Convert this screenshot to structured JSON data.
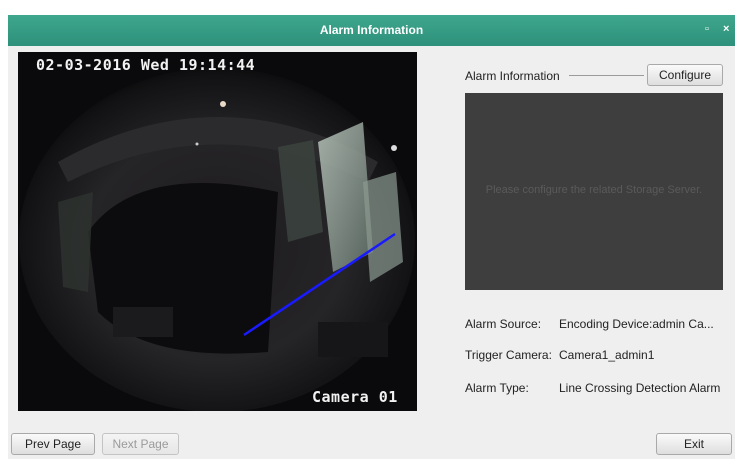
{
  "window": {
    "title": "Alarm Information",
    "restore_glyph": "▫",
    "close_glyph": "×"
  },
  "video": {
    "timestamp": "02-03-2016 Wed 19:14:44",
    "camera_label": "Camera 01",
    "detection_line_color": "#1a1aff"
  },
  "info": {
    "header_label": "Alarm Information",
    "configure_label": "Configure",
    "storage_message": "Please configure the related Storage Server.",
    "alarm_source_label": "Alarm Source:",
    "alarm_source_value": "Encoding Device:admin Ca...",
    "trigger_camera_label": "Trigger Camera:",
    "trigger_camera_value": "Camera1_admin1",
    "alarm_type_label": "Alarm Type:",
    "alarm_type_value": "Line Crossing Detection Alarm"
  },
  "footer": {
    "prev_label": "Prev Page",
    "next_label": "Next Page",
    "exit_label": "Exit"
  },
  "colors": {
    "titlebar": "#2e9a80",
    "storage_panel": "#3e3e3e"
  }
}
